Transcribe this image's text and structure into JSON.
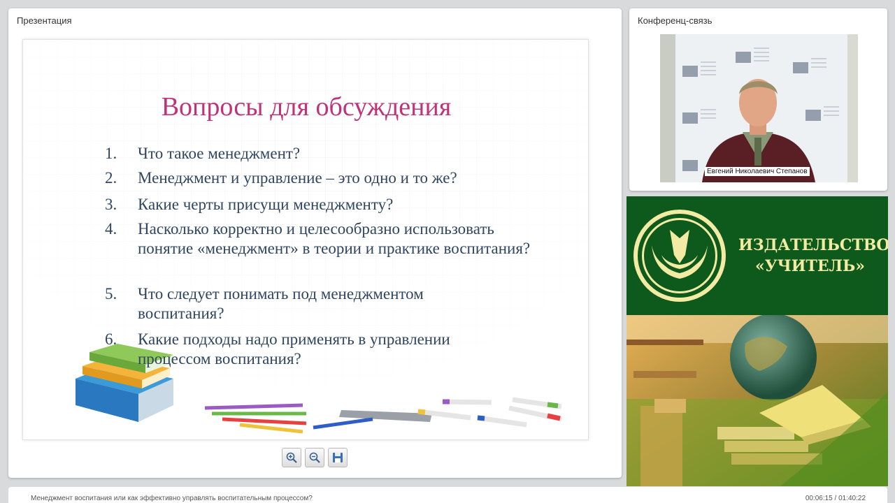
{
  "presentation": {
    "title": "Презентация",
    "slide": {
      "heading": "Вопросы для обсуждения",
      "questions": [
        {
          "num": "1.",
          "text": "Что такое менеджмент?"
        },
        {
          "num": "2.",
          "text": "Менеджмент и управление – это одно и то же?"
        },
        {
          "num": "3.",
          "text": "Какие черты присущи менеджменту?"
        },
        {
          "num": "4.",
          "text": "Насколько корректно и целесообразно использовать понятие «менеджмент» в теории и практике воспитания?"
        },
        {
          "num": "5.",
          "text": "Что следует понимать под менеджментом воспитания?"
        },
        {
          "num": "6.",
          "text": "Какие подходы надо применять в управлении процессом воспитания?"
        }
      ]
    },
    "toolbar": {
      "zoom_in": "zoom-in-icon",
      "zoom_out": "zoom-out-icon",
      "save": "save-icon"
    }
  },
  "conference": {
    "title": "Конференц-связь",
    "speaker_name": "Евгений Николаевич Степанов"
  },
  "banner": {
    "line1": "ИЗДАТЕЛЬСТВО",
    "line2": "«УЧИТЕЛЬ»"
  },
  "footer": {
    "lecture_title": "Менеджмент воспитания или как эффективно управлять воспитательным процессом?",
    "time": "00:06:15 / 01:40:22"
  },
  "colors": {
    "slide_heading": "#c0327a",
    "slide_text": "#2f4560",
    "banner_green": "#0d5a1c",
    "banner_text": "#f3eaa3"
  }
}
